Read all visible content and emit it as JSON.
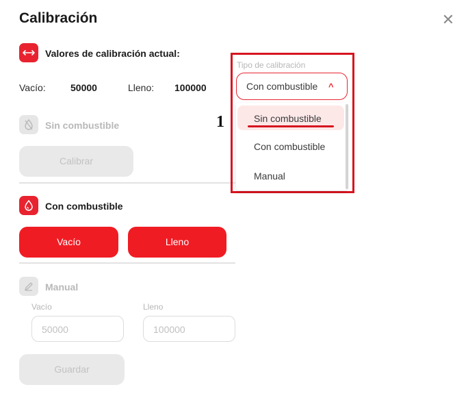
{
  "header": {
    "title": "Calibración",
    "close_icon": "close-icon"
  },
  "current": {
    "title": "Valores de calibración actual:",
    "vacio_label": "Vacío:",
    "vacio_value": "50000",
    "lleno_label": "Lleno:",
    "lleno_value": "100000"
  },
  "sin_combustible": {
    "title": "Sin combustible",
    "button": "Calibrar"
  },
  "con_combustible": {
    "title": "Con combustible",
    "vacio_button": "Vacío",
    "lleno_button": "Lleno"
  },
  "manual": {
    "title": "Manual",
    "vacio_label": "Vacío",
    "vacio_placeholder": "50000",
    "lleno_label": "Lleno",
    "lleno_placeholder": "100000",
    "save_button": "Guardar"
  },
  "dropdown": {
    "label": "Tipo de calibración",
    "selected": "Con combustible",
    "options": [
      "Sin combustible",
      "Con combustible",
      "Manual"
    ]
  },
  "annotation": {
    "step": "1"
  },
  "colors": {
    "accent": "#e8232f",
    "highlight": "#d7131e",
    "disabled": "#e9e9e9"
  }
}
